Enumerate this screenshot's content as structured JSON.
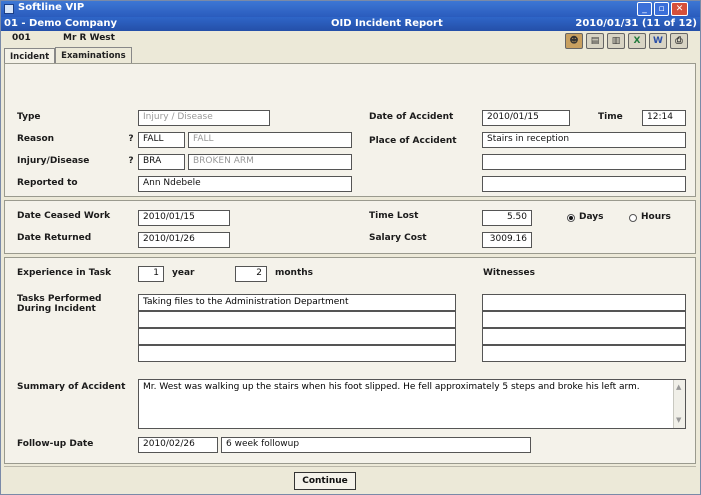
{
  "window": {
    "title": "Softline VIP"
  },
  "infobar": {
    "company": "01 - Demo Company",
    "report": "OID Incident Report",
    "date_record": "2010/01/31 (11 of 12)"
  },
  "employee": {
    "number": "001",
    "name": "Mr R West"
  },
  "toolbar": {
    "icons": [
      "person-icon",
      "sheet-icon",
      "document-icon",
      "excel-icon",
      "word-icon",
      "printer-icon"
    ],
    "glyphs": [
      "☻",
      "▤",
      "▥",
      "X",
      "W",
      "⎙"
    ]
  },
  "tabs": [
    "Incident",
    "Examinations"
  ],
  "incident": {
    "type_label": "Type",
    "type_value": "Injury / Disease",
    "reason_label": "Reason",
    "reason_code": "FALL",
    "reason_desc": "FALL",
    "injury_label": "Injury/Disease",
    "injury_code": "BRA",
    "injury_desc": "BROKEN ARM",
    "reported_label": "Reported to",
    "reported_value": "Ann Ndebele",
    "lookup_symbol": "?",
    "date_label": "Date of Accident",
    "date_value": "2010/01/15",
    "time_label": "Time",
    "time_value": "12:14",
    "place_label": "Place of Accident",
    "place_value": "Stairs in reception",
    "place_line2": "",
    "place_line3": ""
  },
  "work": {
    "ceased_label": "Date Ceased Work",
    "ceased_value": "2010/01/15",
    "returned_label": "Date Returned",
    "returned_value": "2010/01/26",
    "lost_label": "Time Lost",
    "lost_value": "5.50",
    "days_label": "Days",
    "hours_label": "Hours",
    "selected_unit": "Days",
    "salary_label": "Salary Cost",
    "salary_value": "3009.16"
  },
  "task": {
    "experience_label": "Experience in Task",
    "years_value": "1",
    "years_label": "year",
    "months_value": "2",
    "months_label": "months",
    "witnesses_label": "Witnesses",
    "performed_label": "Tasks Performed",
    "performed_label2": "During Incident",
    "tasks": [
      "Taking files to the Administration Department",
      "",
      "",
      ""
    ],
    "witnesses": [
      "",
      "",
      "",
      ""
    ],
    "summary_label": "Summary of Accident",
    "summary_value": "Mr. West was walking up the stairs when his foot slipped. He fell approximately 5 steps and broke his left arm.",
    "followup_label": "Follow-up Date",
    "followup_date": "2010/02/26",
    "followup_note": "6 week followup"
  },
  "actions": {
    "continue_label": "Continue"
  }
}
